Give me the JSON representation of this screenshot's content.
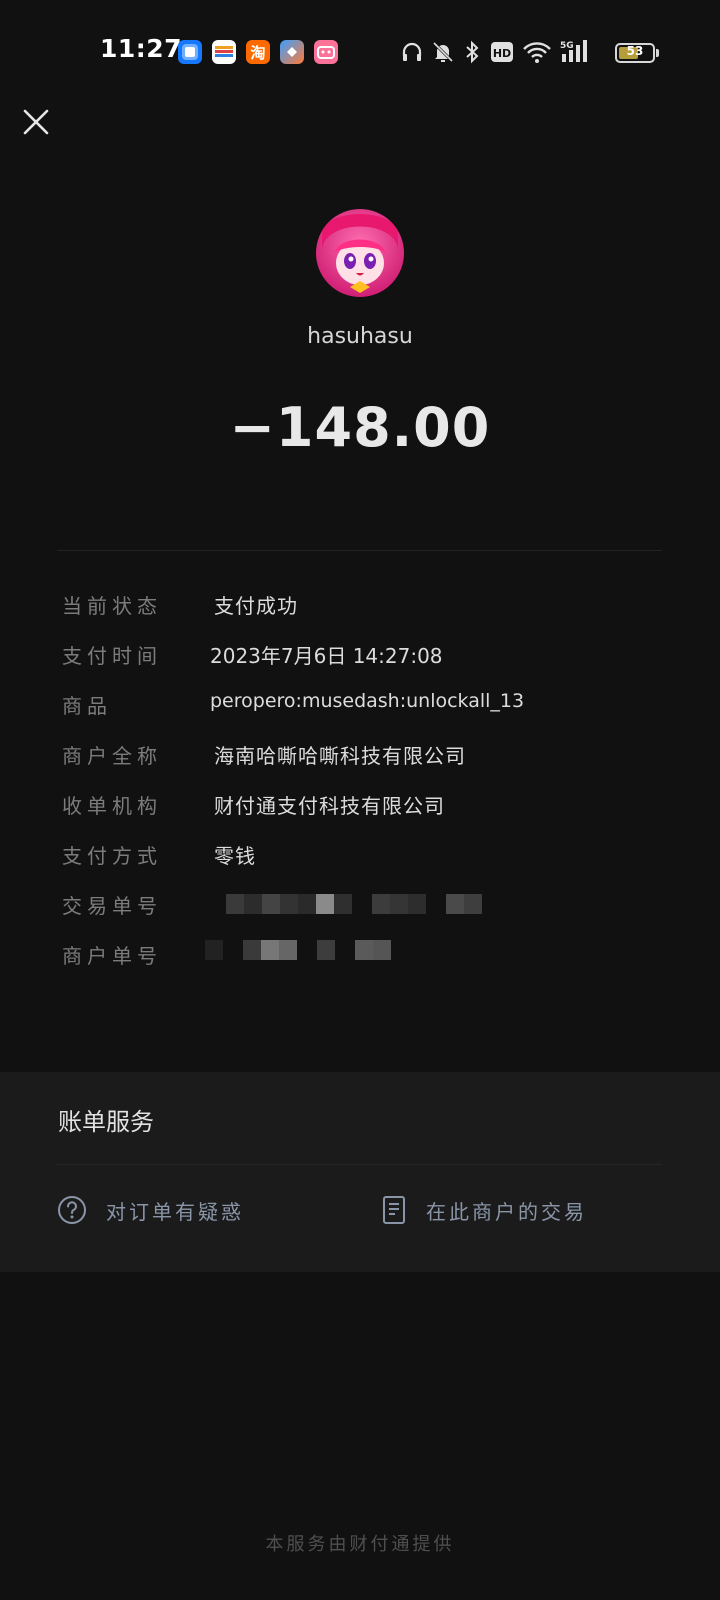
{
  "status_bar": {
    "time": "11:27",
    "battery_level": "53",
    "network": "5G",
    "hd_label": "HD",
    "app_icons": [
      "alipay-app-icon",
      "wallet-app-icon",
      "taobao-app-icon",
      "shortcut-app-icon",
      "bilibili-app-icon"
    ],
    "status_icons": [
      "headphones-icon",
      "bell-off-icon",
      "bluetooth-icon",
      "hd-icon",
      "wifi-icon",
      "signal-icon",
      "battery-icon"
    ]
  },
  "header": {
    "merchant_name": "hasuhasu",
    "amount": "−148.00"
  },
  "details": {
    "rows": [
      {
        "label": "当前状态",
        "value": "支付成功"
      },
      {
        "label": "支付时间",
        "value": "2023年7月6日 14:27:08"
      },
      {
        "label": "商品",
        "value": "peropero:musedash:unlockall_13"
      },
      {
        "label": "商户全称",
        "value": "海南哈嘶哈嘶科技有限公司"
      },
      {
        "label": "收单机构",
        "value": "财付通支付科技有限公司"
      },
      {
        "label": "支付方式",
        "value": "零钱"
      },
      {
        "label": "交易单号",
        "value": ""
      },
      {
        "label": "商户单号",
        "value": ""
      }
    ]
  },
  "service": {
    "title": "账单服务",
    "actions": [
      {
        "label": "对订单有疑惑",
        "icon": "question-icon"
      },
      {
        "label": "在此商户的交易",
        "icon": "document-icon"
      }
    ]
  },
  "footer": {
    "note": "本服务由财付通提供"
  },
  "colors": {
    "background": "#111111",
    "card": "#1b1b1b",
    "label": "#7c7c7c",
    "value": "#dcdcdc",
    "link": "#8a96a8"
  }
}
